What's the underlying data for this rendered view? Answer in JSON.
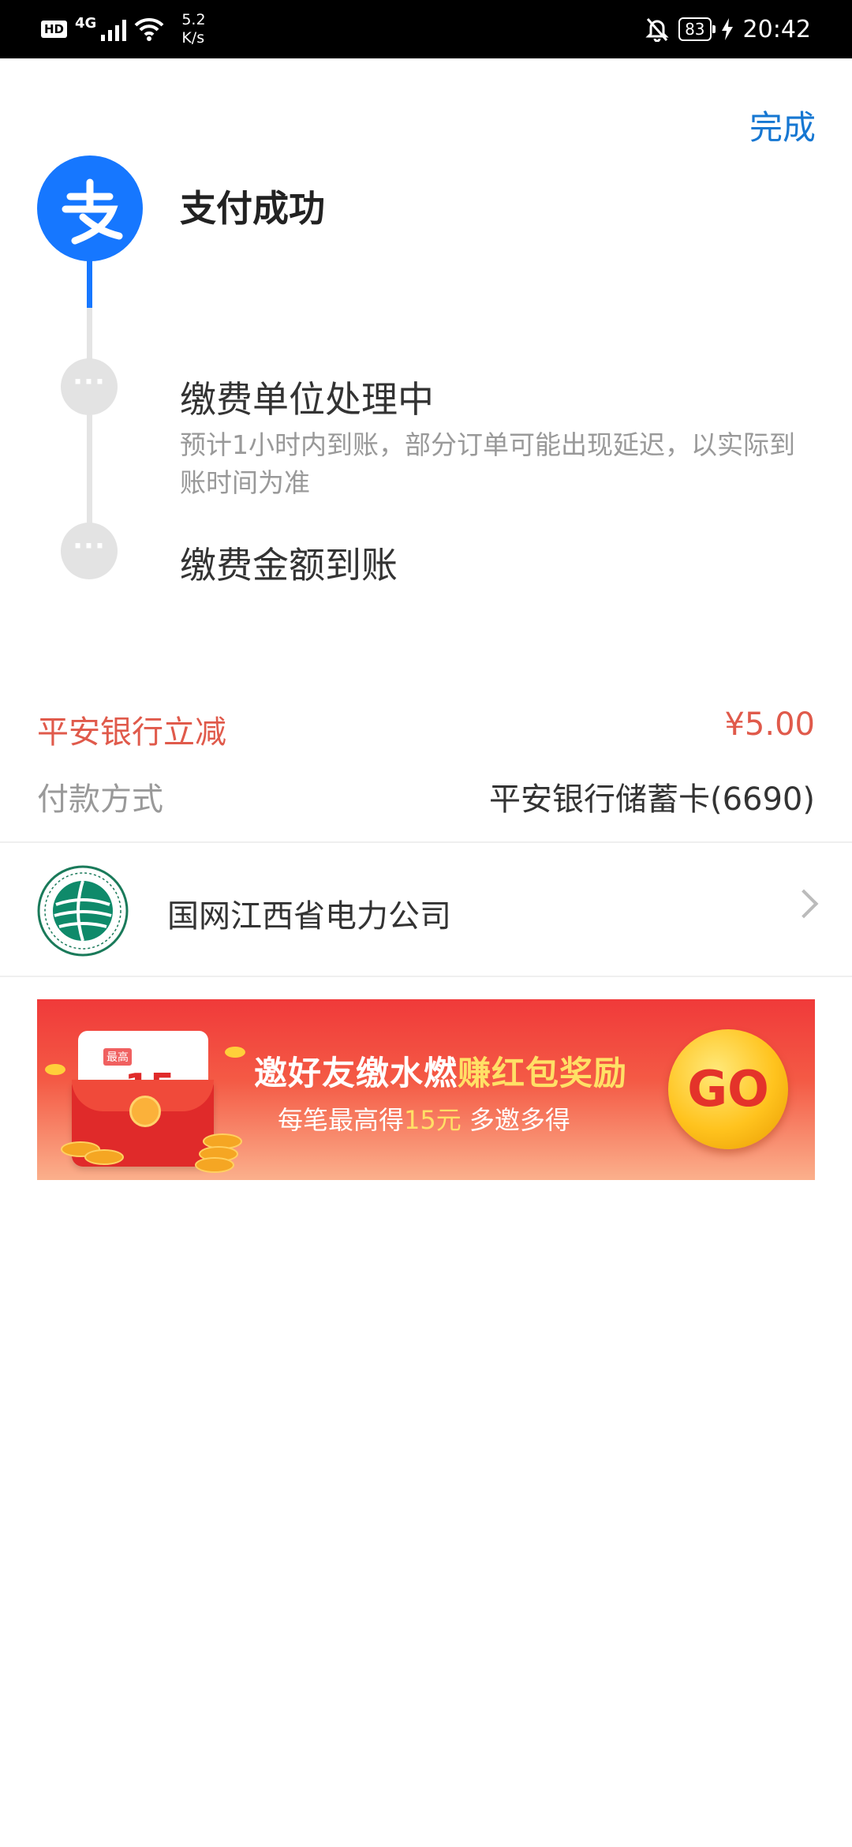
{
  "status_bar": {
    "hd": "HD",
    "network": "4G",
    "speed_value": "5.2",
    "speed_unit": "K/s",
    "battery": "83",
    "time": "20:42"
  },
  "header": {
    "done_label": "完成"
  },
  "steps": [
    {
      "title": "支付成功"
    },
    {
      "title": "缴费单位处理中",
      "desc": "预计1小时内到账，部分订单可能出现延迟，以实际到账时间为准"
    },
    {
      "title": "缴费金额到账"
    }
  ],
  "discount": {
    "label": "平安银行立减",
    "amount": "¥5.00"
  },
  "payment": {
    "label": "付款方式",
    "value": "平安银行储蓄卡(6690)"
  },
  "merchant": {
    "name": "国网江西省电力公司"
  },
  "banner": {
    "tag": "最高",
    "amount_prefix": "每笔",
    "amount_value": "15",
    "amount_suffix": "元",
    "line1_main": "邀好友缴水燃",
    "line1_highlight": "赚红包奖励",
    "line2_prefix": "每笔最高得",
    "line2_highlight": "15元",
    "line2_suffix": " 多邀多得",
    "go_label": "GO"
  },
  "colors": {
    "brand_blue": "#1677ff",
    "link_blue": "#1677d2",
    "discount_red": "#e05a4b"
  }
}
